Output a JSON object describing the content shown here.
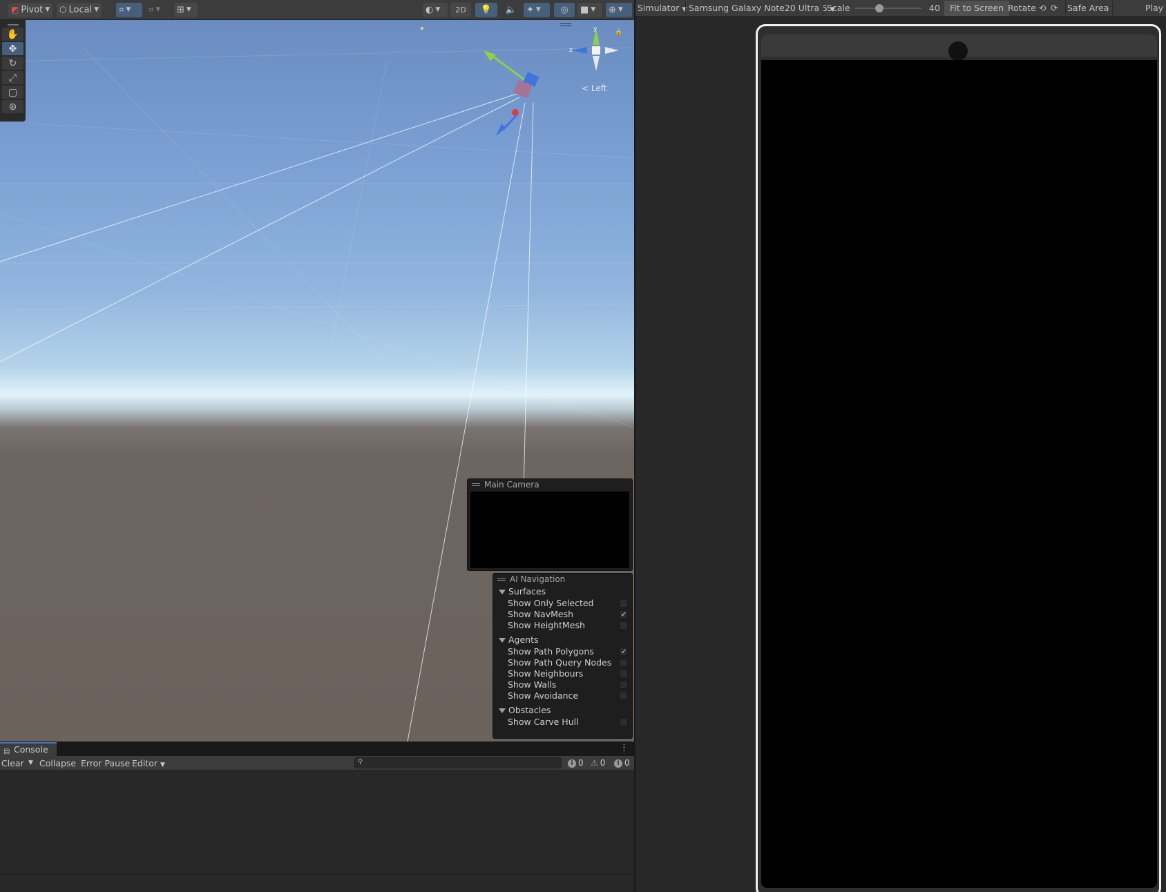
{
  "scene_toolbar": {
    "pivot_label": "Pivot",
    "local_label": "Local",
    "mode_2d_label": "2D"
  },
  "gizmo": {
    "y_axis": "y",
    "z_axis": "z",
    "view_label": "Left"
  },
  "main_camera": {
    "title": "Main Camera"
  },
  "ai_navigation": {
    "title": "AI Navigation",
    "sections": [
      {
        "label": "Surfaces",
        "options": [
          {
            "label": "Show Only Selected",
            "checked": false
          },
          {
            "label": "Show NavMesh",
            "checked": true
          },
          {
            "label": "Show HeightMesh",
            "checked": false
          }
        ]
      },
      {
        "label": "Agents",
        "options": [
          {
            "label": "Show Path Polygons",
            "checked": true
          },
          {
            "label": "Show Path Query Nodes",
            "checked": false
          },
          {
            "label": "Show Neighbours",
            "checked": false
          },
          {
            "label": "Show Walls",
            "checked": false
          },
          {
            "label": "Show Avoidance",
            "checked": false
          }
        ]
      },
      {
        "label": "Obstacles",
        "options": [
          {
            "label": "Show Carve Hull",
            "checked": false
          }
        ]
      }
    ]
  },
  "console": {
    "tab_label": "Console",
    "clear_label": "Clear",
    "collapse_label": "Collapse",
    "error_pause_label": "Error Pause",
    "editor_label": "Editor",
    "search_placeholder": "",
    "info_count": "0",
    "warning_count": "0",
    "error_count": "0"
  },
  "simulator": {
    "mode_label": "Simulator",
    "device_label": "Samsung Galaxy Note20 Ultra 5",
    "scale_label": "Scale",
    "scale_value": "40",
    "fit_label": "Fit to Screen",
    "rotate_label": "Rotate",
    "safe_area_label": "Safe Area",
    "play_label": "Play"
  },
  "colors": {
    "accent": "#46607c",
    "tab_highlight": "#3a79bb",
    "y_axis": "#8cd04a",
    "z_axis": "#3f74e0",
    "x_axis": "#e03c3c"
  }
}
